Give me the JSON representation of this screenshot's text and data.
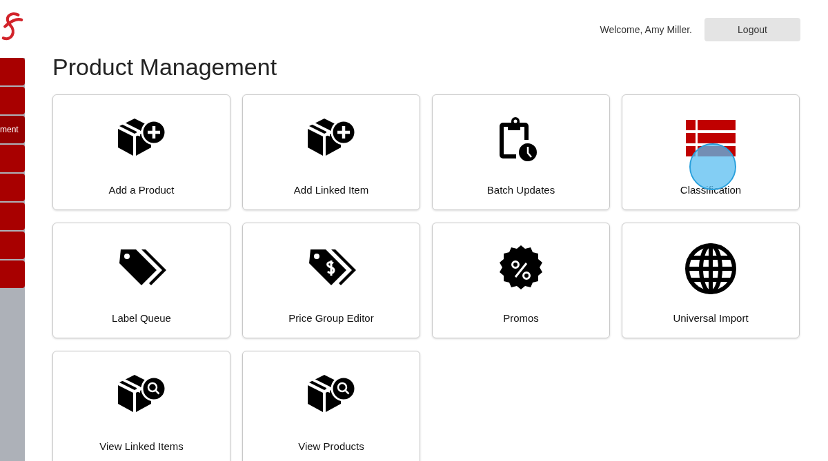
{
  "sidebar": {
    "items": [
      {
        "selected": false
      },
      {
        "selected": false
      },
      {
        "label": "ment",
        "selected": true
      },
      {
        "selected": false
      },
      {
        "selected": false
      },
      {
        "selected": false
      },
      {
        "selected": false
      },
      {
        "selected": false
      }
    ]
  },
  "header": {
    "welcome": "Welcome, Amy Miller.",
    "logout": "Logout"
  },
  "page": {
    "title": "Product Management"
  },
  "tiles": [
    {
      "label": "Add a Product",
      "kind": "add",
      "clicked": false
    },
    {
      "label": "Add Linked Item",
      "kind": "add",
      "clicked": false
    },
    {
      "label": "Batch Updates",
      "kind": "clipboard",
      "clicked": false
    },
    {
      "label": "Classification",
      "kind": "grid",
      "clicked": true
    },
    {
      "label": "Label Queue",
      "kind": "tags",
      "clicked": false
    },
    {
      "label": "Price Group Editor",
      "kind": "pricetags",
      "clicked": false
    },
    {
      "label": "Promos",
      "kind": "badge",
      "clicked": false
    },
    {
      "label": "Universal Import",
      "kind": "globe",
      "clicked": false
    },
    {
      "label": "View Linked Items",
      "kind": "search",
      "clicked": false
    },
    {
      "label": "View Products",
      "kind": "search",
      "clicked": false
    }
  ]
}
